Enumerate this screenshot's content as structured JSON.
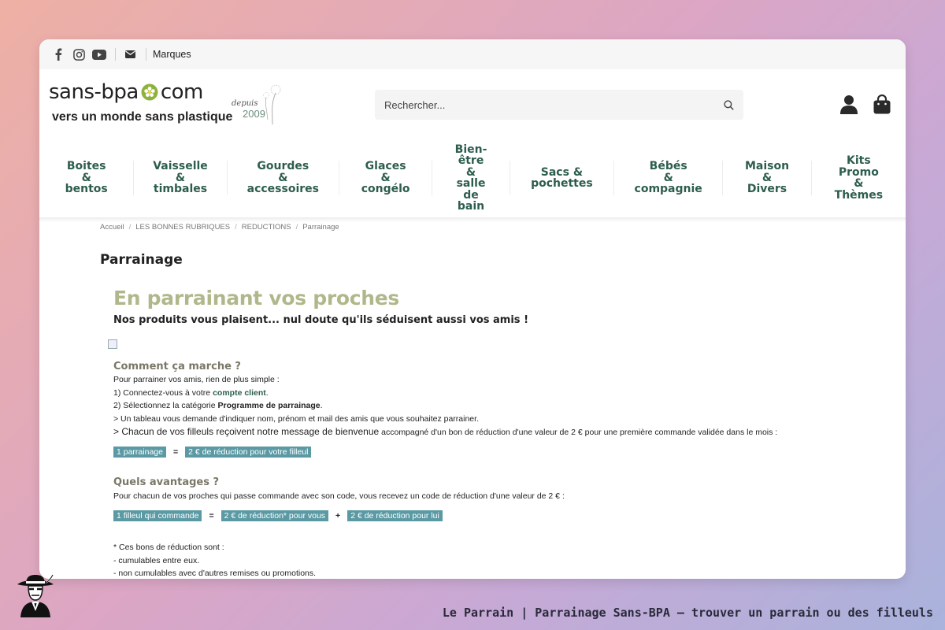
{
  "topbar": {
    "icons": [
      "facebook-icon",
      "instagram-icon",
      "youtube-icon",
      "envelope-icon"
    ],
    "marques_label": "Marques"
  },
  "logo": {
    "line1_left": "sans-bpa",
    "line1_right": "com",
    "tagline": "vers un monde sans plastique",
    "depuis": "depuis",
    "year": "2009"
  },
  "search": {
    "placeholder": "Rechercher..."
  },
  "nav": {
    "items": [
      {
        "label": "Boites\n&\nbentos"
      },
      {
        "label": "Vaisselle\n&\ntimbales"
      },
      {
        "label": "Gourdes\n&\naccessoires"
      },
      {
        "label": "Glaces\n&\ncongélo"
      },
      {
        "label": "Bien-\nêtre\n&\nsalle\nde\nbain"
      },
      {
        "label": "Sacs &\npochettes"
      },
      {
        "label": "Bébés\n&\ncompagnie"
      },
      {
        "label": "Maison\n&\nDivers"
      },
      {
        "label": "Kits\nPromo\n&\nThèmes"
      }
    ]
  },
  "breadcrumb": [
    "Accueil",
    "LES BONNES RUBRIQUES",
    "REDUCTIONS",
    "Parrainage"
  ],
  "breadcrumb_sep": "/",
  "page_title": "Parrainage",
  "content": {
    "hero_title": "En parrainant vos proches",
    "hero_subtitle": "Nos produits vous plaisent... nul doute qu'ils séduisent aussi vos amis !",
    "how_heading": "Comment ça marche ?",
    "how_intro": "Pour parrainer vos amis, rien de plus simple :",
    "step1_prefix": "1) Connectez-vous à votre ",
    "step1_link": "compte client",
    "step1_suffix": ".",
    "step2_prefix": "2) Sélectionnez la catégorie ",
    "step2_bold": "Programme de parrainage",
    "step2_suffix": ".",
    "step3": "> Un tableau vous demande d'indiquer nom, prénom et mail des amis que vous souhaitez parrainer.",
    "step4_big": "> Chacun de vos filleuls reçoivent notre message de bienvenue",
    "step4_rest": " accompagné d'un bon de réduction d'une valeur de 2 € pour une première commande validée dans le mois :",
    "formula1": {
      "left": "1 parrainage",
      "op": "=",
      "right": "2 € de réduction pour votre filleul"
    },
    "adv_heading": "Quels avantages ?",
    "adv_text": "Pour chacun de vos proches qui passe commande avec son code, vous recevez un code de réduction d'une valeur de 2 € :",
    "formula2": {
      "a": "1 filleul qui commande",
      "op1": "=",
      "b": "2 € de réduction* pour vous",
      "op2": "+",
      "c": "2 € de réduction pour lui"
    },
    "note_title": "* Ces bons de réduction sont :",
    "note_1": "- cumulables entre eux.",
    "note_2": "- non cumulables avec d'autres remises ou promotions."
  },
  "caption": "Le Parrain | Parrainage Sans-BPA — trouver un parrain ou des filleuls",
  "colors": {
    "nav_green": "#2d5d4e",
    "hero_olive": "#b0b88b",
    "chip_teal": "#5b9aa4"
  }
}
